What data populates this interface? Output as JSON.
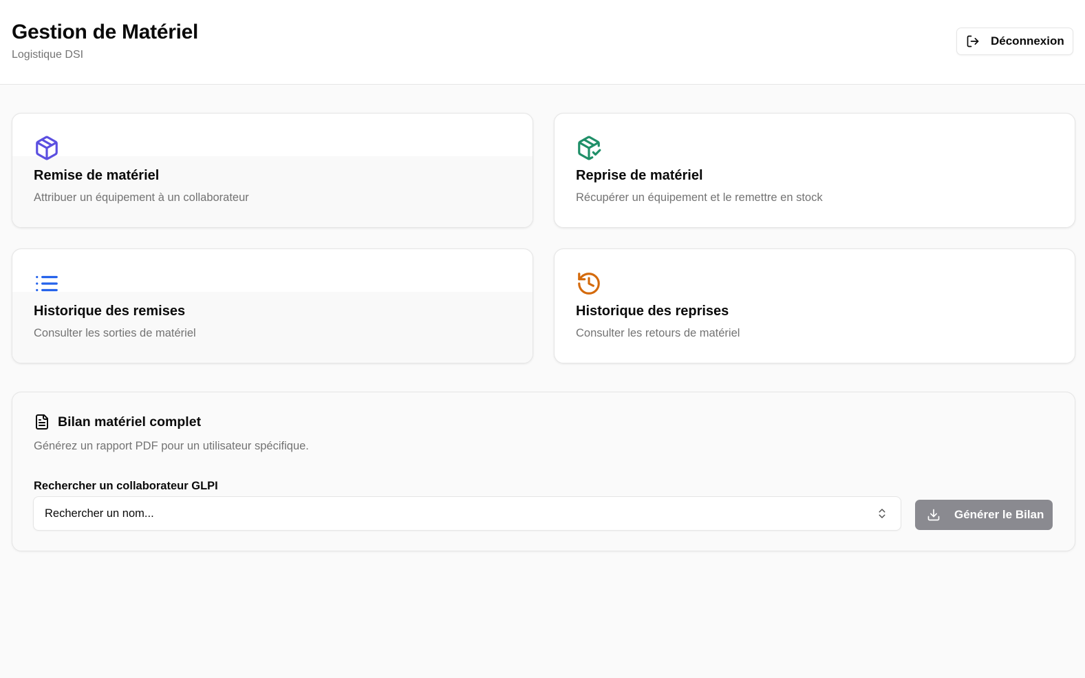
{
  "header": {
    "title": "Gestion de Matériel",
    "subtitle": "Logistique DSI",
    "logout_label": "Déconnexion"
  },
  "cards": [
    {
      "title": "Remise de matériel",
      "description": "Attribuer un équipement à un collaborateur",
      "icon": "package-icon",
      "color": "#5b4fe0"
    },
    {
      "title": "Reprise de matériel",
      "description": "Récupérer un équipement et le remettre en stock",
      "icon": "package-check-icon",
      "color": "#1f8f68"
    },
    {
      "title": "Historique des remises",
      "description": "Consulter les sorties de matériel",
      "icon": "list-icon",
      "color": "#2563eb"
    },
    {
      "title": "Historique des reprises",
      "description": "Consulter les retours de matériel",
      "icon": "history-icon",
      "color": "#d46a0c"
    }
  ],
  "report": {
    "title": "Bilan matériel complet",
    "description": "Générez un rapport PDF pour un utilisateur spécifique.",
    "search_label": "Rechercher un collaborateur GLPI",
    "search_placeholder": "Rechercher un nom...",
    "generate_label": "Générer le Bilan"
  }
}
